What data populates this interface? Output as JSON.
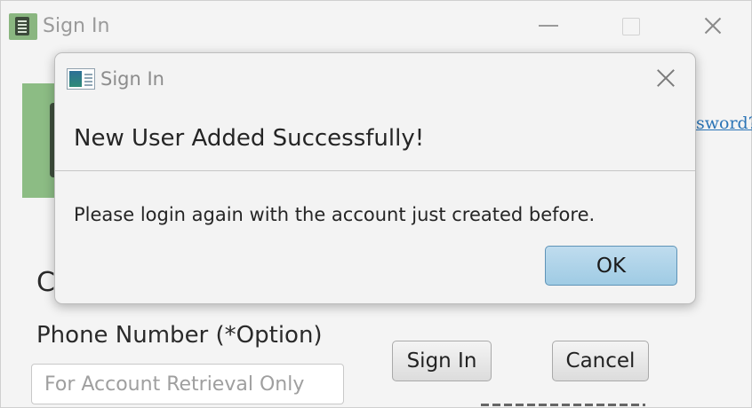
{
  "main_window": {
    "title": "Sign In",
    "forgot_link": "sword?",
    "partial_label": "C",
    "phone_label": "Phone Number (*Option)",
    "phone_placeholder": "For Account Retrieval Only",
    "signin_button": "Sign In",
    "cancel_button": "Cancel",
    "icon": "calculator-icon",
    "accent_color": "#8cbc84",
    "link_color": "#2a74b6"
  },
  "dialog": {
    "title": "Sign In",
    "heading": "New User Added Successfully!",
    "message": "Please login again with the account just created before.",
    "ok_button": "OK",
    "icon": "app-window-icon",
    "ok_color": "#a9d1ea"
  }
}
